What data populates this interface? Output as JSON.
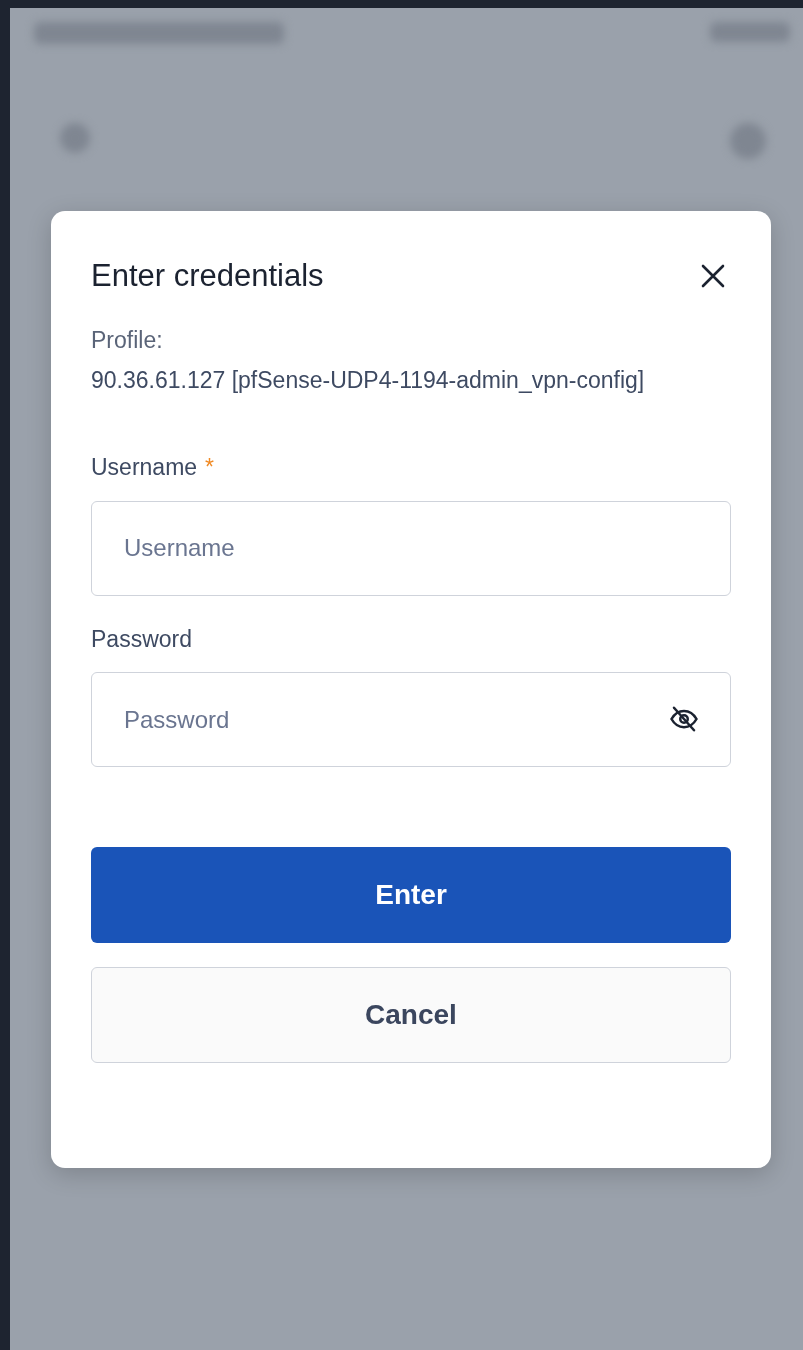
{
  "dialog": {
    "title": "Enter credentials",
    "profile_label": "Profile:",
    "profile_value": "90.36.61.127 [pfSense-UDP4-1194-admin_vpn-config]",
    "fields": [
      {
        "kind": "text",
        "label": "Username",
        "required_mark": "*",
        "placeholder": "Username"
      },
      {
        "kind": "password",
        "label": "Password",
        "placeholder": "Password"
      }
    ],
    "buttons": [
      {
        "kind": "primary",
        "label": "Enter"
      },
      {
        "kind": "secondary",
        "label": "Cancel"
      }
    ]
  }
}
